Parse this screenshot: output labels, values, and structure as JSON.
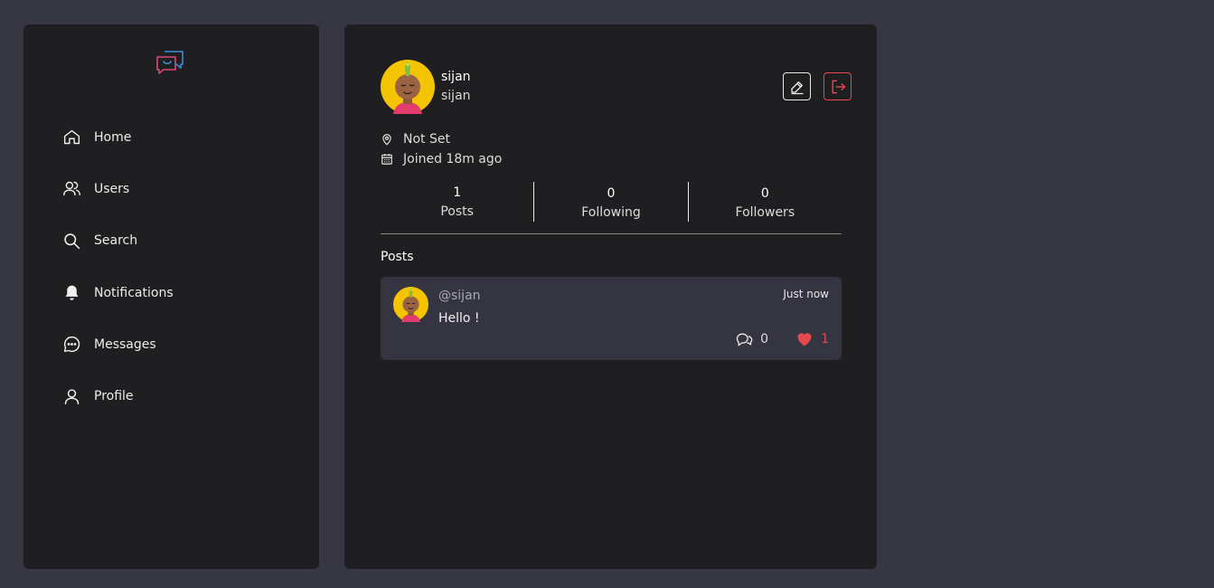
{
  "sidebar": {
    "logo_icon": "chat-bubbles-logo",
    "items": [
      {
        "label": "Home",
        "icon": "home-icon"
      },
      {
        "label": "Users",
        "icon": "users-icon"
      },
      {
        "label": "Search",
        "icon": "search-icon"
      },
      {
        "label": "Notifications",
        "icon": "bell-icon"
      },
      {
        "label": "Messages",
        "icon": "message-icon"
      },
      {
        "label": "Profile",
        "icon": "user-icon"
      }
    ]
  },
  "profile": {
    "name": "sijan",
    "handle": "sijan",
    "location": "Not Set",
    "joined": "Joined 18m ago",
    "stats": [
      {
        "value": "1",
        "label": "Posts"
      },
      {
        "value": "0",
        "label": "Following"
      },
      {
        "value": "0",
        "label": "Followers"
      }
    ]
  },
  "posts_section": {
    "title": "Posts",
    "posts": [
      {
        "user": "@sijan",
        "time": "Just now",
        "body": "Hello !",
        "comments": "0",
        "likes": "1"
      }
    ]
  },
  "colors": {
    "background": "#373643",
    "panel": "#1f1f22",
    "post_card": "#353441",
    "accent_red": "#e5484d",
    "avatar_yellow": "#f5c400"
  }
}
